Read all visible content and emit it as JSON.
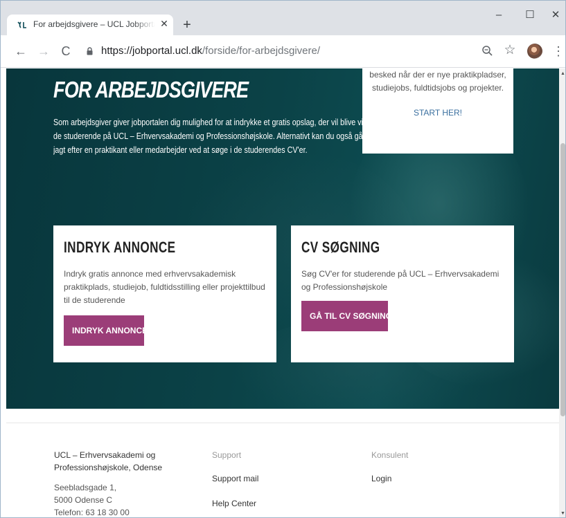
{
  "browser": {
    "tab_title": "For arbejdsgivere – UCL Jobportal",
    "url_host": "https://jobportal.ucl.dk",
    "url_path": "/forside/for-arbejdsgivere/"
  },
  "hero": {
    "title": "FOR ARBEJDSGIVERE",
    "text": "Som arbejdsgiver giver jobportalen dig mulighed for at indrykke et gratis opslag, der vil blive vist for de studerende på UCL – Erhvervsakademi og Professionshøjskole. Alternativt kan du også gå på jagt efter en praktikant eller medarbejder ved at søge i de studerendes CV'er."
  },
  "signup": {
    "text": "besked når der er nye praktikpladser, studiejobs, fuldtidsjobs og projekter.",
    "link": "START HER!"
  },
  "cards": [
    {
      "title": "INDRYK ANNONCE",
      "text": "Indryk gratis annonce med erhvervsakademisk praktikplads, studiejob, fuldtidsstilling eller projekttilbud til de studerende",
      "button": "INDRYK ANNONCE"
    },
    {
      "title": "CV SØGNING",
      "text": "Søg CV'er for studerende på UCL – Erhvervsakademi og Professionshøjskole",
      "button": "GÅ TIL CV SØGNING"
    }
  ],
  "footer": {
    "org_name": "UCL – Erhvervsakademi og Professionshøjskole, Odense",
    "address_line1": "Seebladsgade 1,",
    "address_line2": "5000 Odense C",
    "phone": "Telefon: 63 18 30 00",
    "support_heading": "Support",
    "support_mail": "Support mail",
    "help_center": "Help Center",
    "konsulent_heading": "Konsulent",
    "login": "Login"
  },
  "colors": {
    "hero_bg": "#0b4247",
    "button": "#9b3d78",
    "link": "#3a6f9f"
  }
}
